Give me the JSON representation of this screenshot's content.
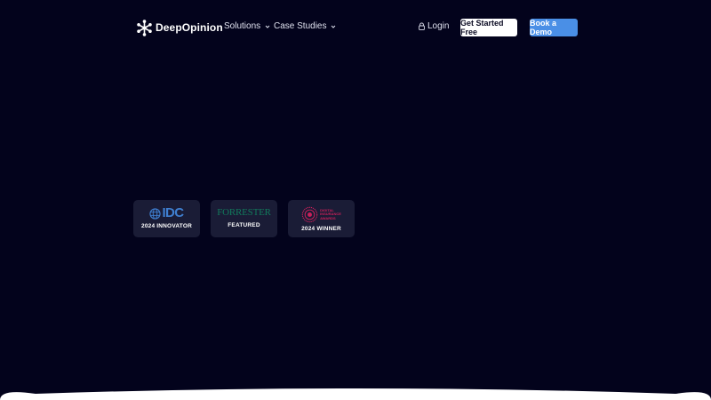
{
  "brand": {
    "name": "DeepOpinion",
    "logo_icon": "asterisk-burst-icon"
  },
  "nav": {
    "solutions_label": "Solutions",
    "case_studies_label": "Case Studies",
    "login_label": "Login",
    "get_started_label": "Get Started Free",
    "book_demo_label": "Book a Demo"
  },
  "badges": {
    "idc": {
      "logo_text": "IDC",
      "label": "2024 INNOVATOR"
    },
    "forrester": {
      "logo_text": "FORRESTER",
      "label": "FEATURED"
    },
    "award": {
      "logo_lines": [
        "DIGITAL",
        "INSURANCE",
        "AWARDS"
      ],
      "label": "2024 WINNER"
    }
  },
  "colors": {
    "background": "#03031c",
    "badge_bg": "#1a1c36",
    "demo_button": "#4a8fe6",
    "idc_blue": "#3f7fd0",
    "forrester_green": "#127a5c",
    "award_magenta": "#c9205a"
  }
}
